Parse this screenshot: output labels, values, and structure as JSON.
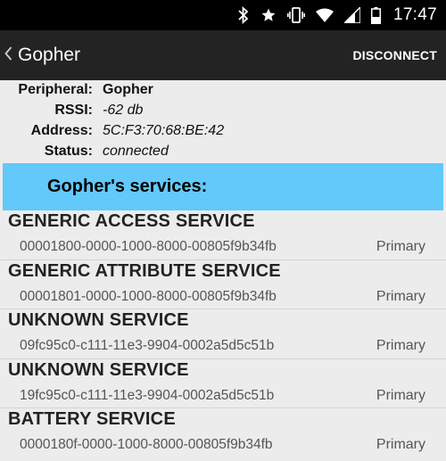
{
  "status_bar": {
    "time": "17:47",
    "icons": [
      "bluetooth-icon",
      "star-icon",
      "vibrate-icon",
      "wifi-icon",
      "signal-icon",
      "battery-icon"
    ]
  },
  "action_bar": {
    "title": "Gopher",
    "disconnect_label": "DISCONNECT"
  },
  "peripheral_info": {
    "peripheral_label": "Peripheral:",
    "peripheral_value": "Gopher",
    "rssi_label": "RSSI:",
    "rssi_value": "-62 db",
    "address_label": "Address:",
    "address_value": "5C:F3:70:68:BE:42",
    "status_label": "Status:",
    "status_value": "connected"
  },
  "services_header": "Gopher's services:",
  "services": [
    {
      "name": "GENERIC ACCESS SERVICE",
      "uuid": "00001800-0000-1000-8000-00805f9b34fb",
      "type": "Primary"
    },
    {
      "name": "GENERIC ATTRIBUTE SERVICE",
      "uuid": "00001801-0000-1000-8000-00805f9b34fb",
      "type": "Primary"
    },
    {
      "name": "UNKNOWN SERVICE",
      "uuid": "09fc95c0-c111-11e3-9904-0002a5d5c51b",
      "type": "Primary"
    },
    {
      "name": "UNKNOWN SERVICE",
      "uuid": "19fc95c0-c111-11e3-9904-0002a5d5c51b",
      "type": "Primary"
    },
    {
      "name": "BATTERY SERVICE",
      "uuid": "0000180f-0000-1000-8000-00805f9b34fb",
      "type": "Primary"
    }
  ],
  "colors": {
    "status_bar_bg": "#000000",
    "action_bar_bg": "#232323",
    "services_header_bg": "#63c8fa",
    "page_bg": "#ececec"
  }
}
